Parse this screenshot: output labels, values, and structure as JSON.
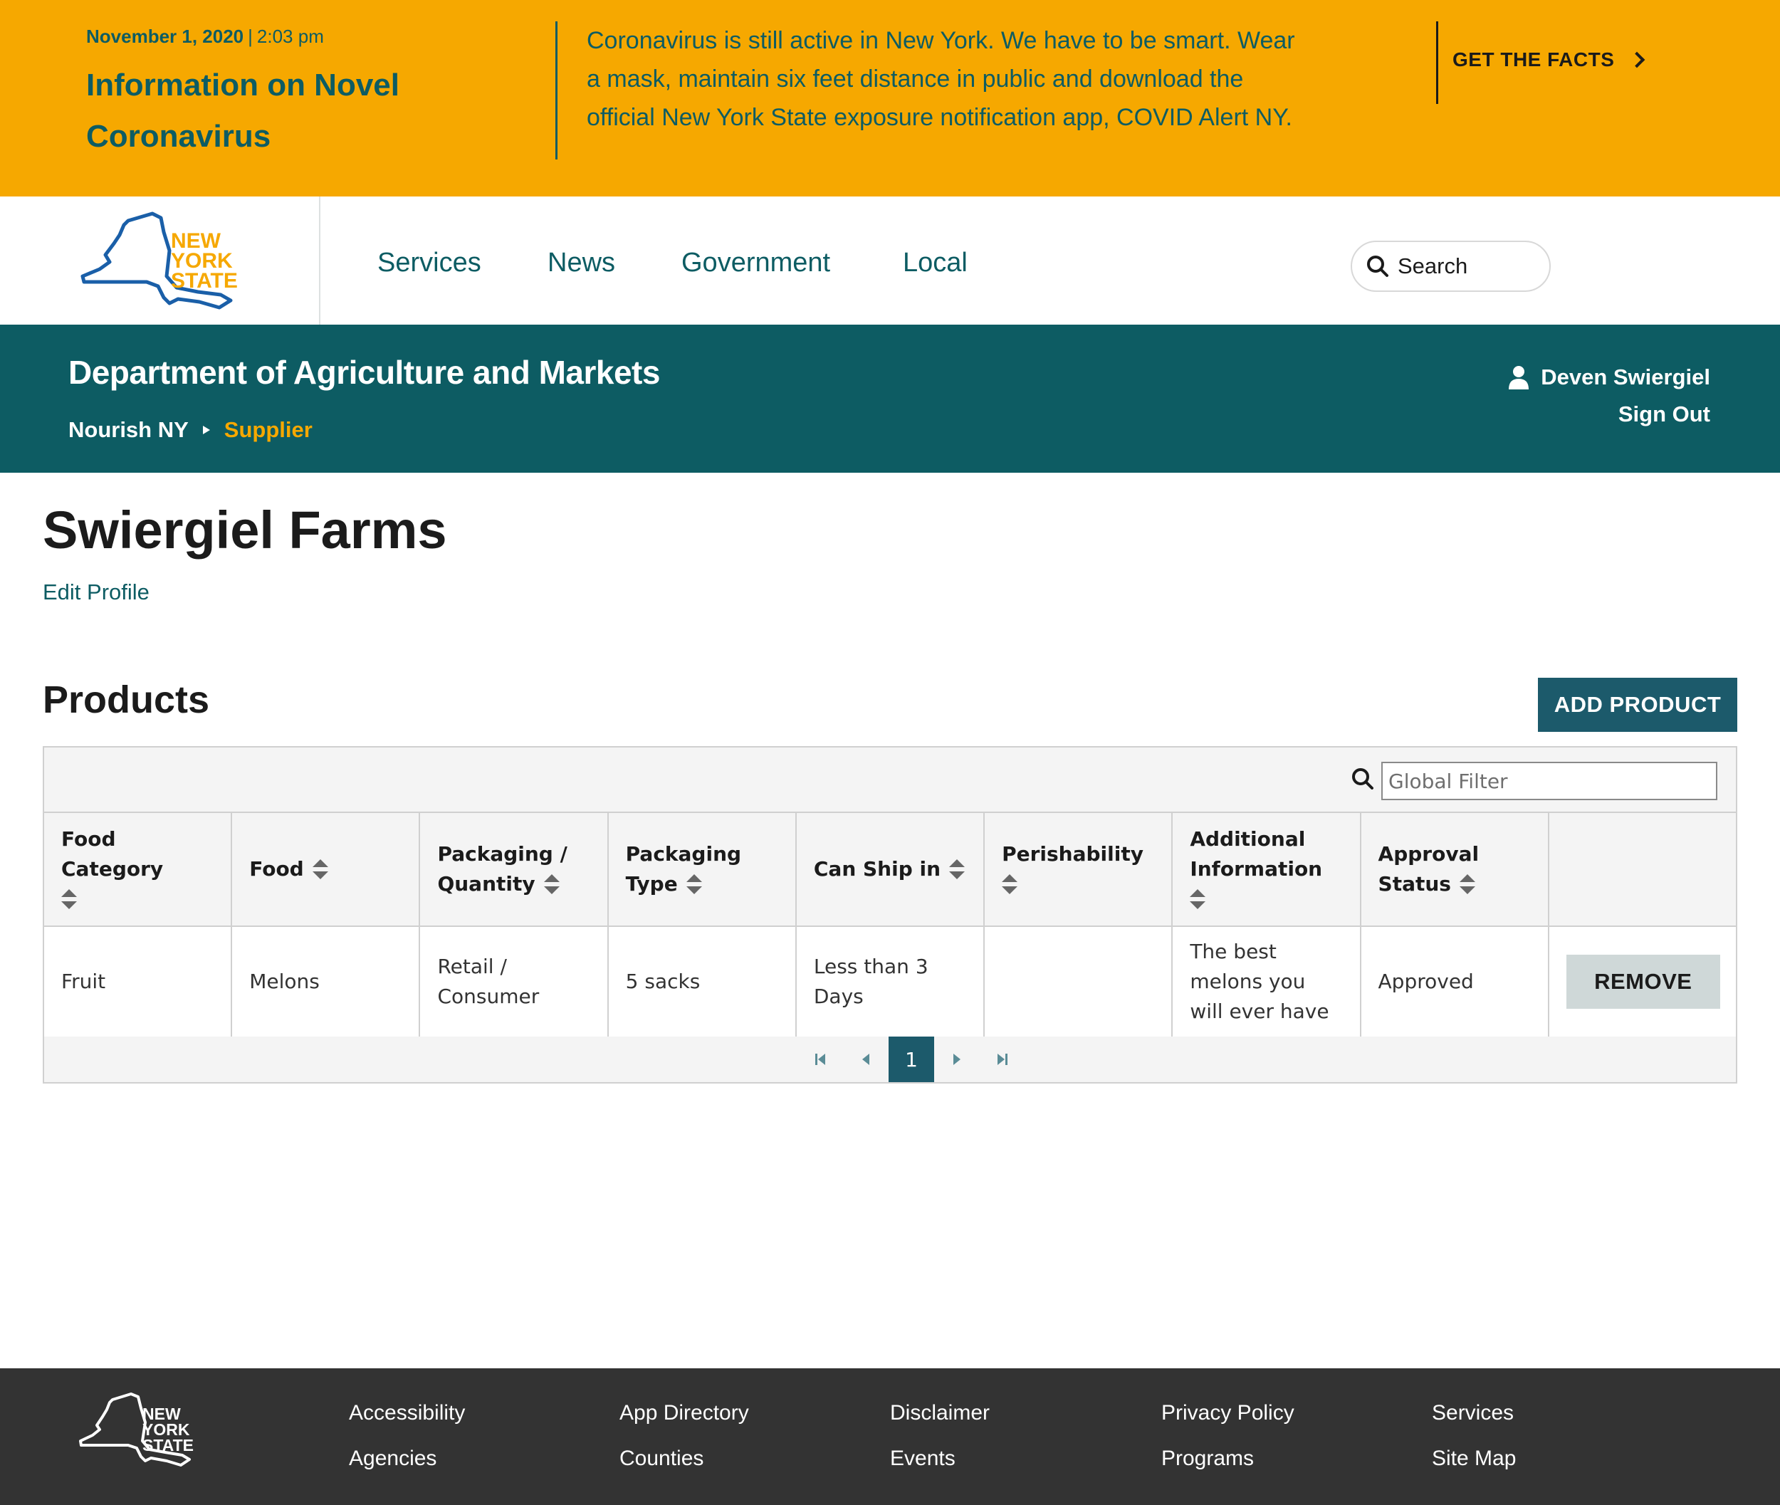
{
  "alert": {
    "date": "November 1, 2020",
    "separator": "|",
    "time": "2:03 pm",
    "title": "Information on Novel Coronavirus",
    "message": "Coronavirus is still active in New York. We have to be smart. Wear a mask, maintain six feet distance in public and download the official New York State exposure notification app, COVID Alert NY.",
    "cta": "GET THE FACTS"
  },
  "logo": {
    "line1": "NEW",
    "line2": "YORK",
    "line3": "STATE"
  },
  "nav": {
    "links": [
      "Services",
      "News",
      "Government",
      "Local"
    ],
    "search_label": "Search"
  },
  "agency": {
    "title": "Department of Agriculture and Markets",
    "breadcrumb": [
      "Nourish NY",
      "Supplier"
    ],
    "user_name": "Deven Swiergiel",
    "sign_out": "Sign Out"
  },
  "main": {
    "title": "Swiergiel Farms",
    "edit_profile": "Edit Profile",
    "products_heading": "Products",
    "add_product": "ADD PRODUCT"
  },
  "table": {
    "filter_placeholder": "Global Filter",
    "columns": [
      "Food Category",
      "Food",
      "Packaging / Quantity",
      "Packaging Type",
      "Can Ship in",
      "Perishability",
      "Additional Information",
      "Approval Status",
      ""
    ],
    "rows": [
      {
        "food_category": "Fruit",
        "food": "Melons",
        "packaging_quantity": "Retail / Consumer",
        "packaging_type": "5 sacks",
        "can_ship_in": "Less than 3 Days",
        "perishability": "",
        "additional_information": "The best melons you will ever have",
        "approval_status": "Approved",
        "action": "REMOVE"
      }
    ],
    "pager": {
      "current_page": "1"
    }
  },
  "footer": {
    "links": [
      "Accessibility",
      "Agencies",
      "App Directory",
      "Counties",
      "Disclaimer",
      "Events",
      "Privacy Policy",
      "Programs",
      "Services",
      "Site Map"
    ]
  },
  "colors": {
    "alert_bg": "#f6a800",
    "brand_teal": "#0d5c63",
    "button_teal": "#1c5a6b",
    "footer_bg": "#333333"
  }
}
